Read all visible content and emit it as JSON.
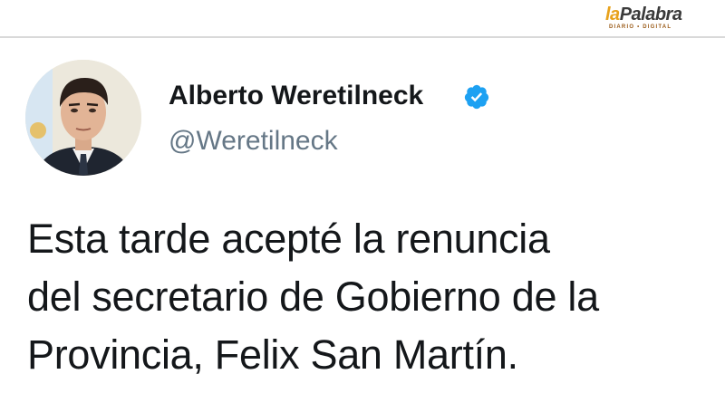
{
  "watermark": {
    "logo_la": "la",
    "logo_palabra": "Palabra",
    "logo_sub": "DIARIO • DIGITAL",
    "accent_color": "#e8a21c"
  },
  "tweet": {
    "author": {
      "name": "Alberto Weretilneck",
      "handle": "@Weretilneck",
      "verified": true,
      "verified_icon": "verified-badge-icon",
      "verified_color": "#1da1f2"
    },
    "text_lines": [
      "Esta tarde acepté la renuncia",
      "del secretario de Gobierno de la",
      "Provincia, Felix San Martín."
    ]
  }
}
